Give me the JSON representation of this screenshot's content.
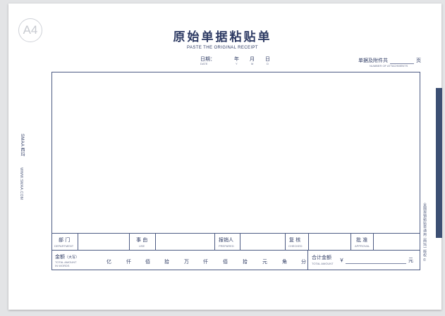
{
  "logo": {
    "text": "A4"
  },
  "header": {
    "title": "原始单据粘贴单",
    "subtitle": "PASTE THE ORIGINAL RECEIPT"
  },
  "date": {
    "label": "日期：",
    "label_en": "DATE",
    "year": "年",
    "year_en": "Y",
    "month": "月",
    "month_en": "M",
    "day": "日",
    "day_en": "D"
  },
  "attachments": {
    "label": "单据及附件共",
    "unit": "页",
    "label_en": "NUMBER OF ATTACHMENTS"
  },
  "row1": {
    "department": {
      "label": "部 门",
      "en": "DEPARTMENT"
    },
    "use": {
      "label": "事 由",
      "en": "USE"
    },
    "prepared": {
      "label": "报销人",
      "en": "PREPARED"
    },
    "checked": {
      "label": "复 核",
      "en": "CHECKED"
    },
    "approval": {
      "label": "批 准",
      "en": "APPROVAL"
    }
  },
  "row2": {
    "amount_label": "金额",
    "amount_note": "（大写）",
    "amount_en_1": "TOTAL AMOUNT",
    "amount_en_2": "IN WORDS",
    "units": [
      "亿",
      "仟",
      "佰",
      "拾",
      "万",
      "仟",
      "佰",
      "拾",
      "元",
      "角",
      "分"
    ],
    "total_label": "合计金额",
    "total_en": "TOTAL AMOUNT",
    "currency": "￥",
    "yuan": "元"
  },
  "side": {
    "brand": "SMAA 西玛",
    "url": "WWW.SMAA.COM",
    "right_text": "全国报销粘贴单通用 (西玛) 版权 ©"
  }
}
